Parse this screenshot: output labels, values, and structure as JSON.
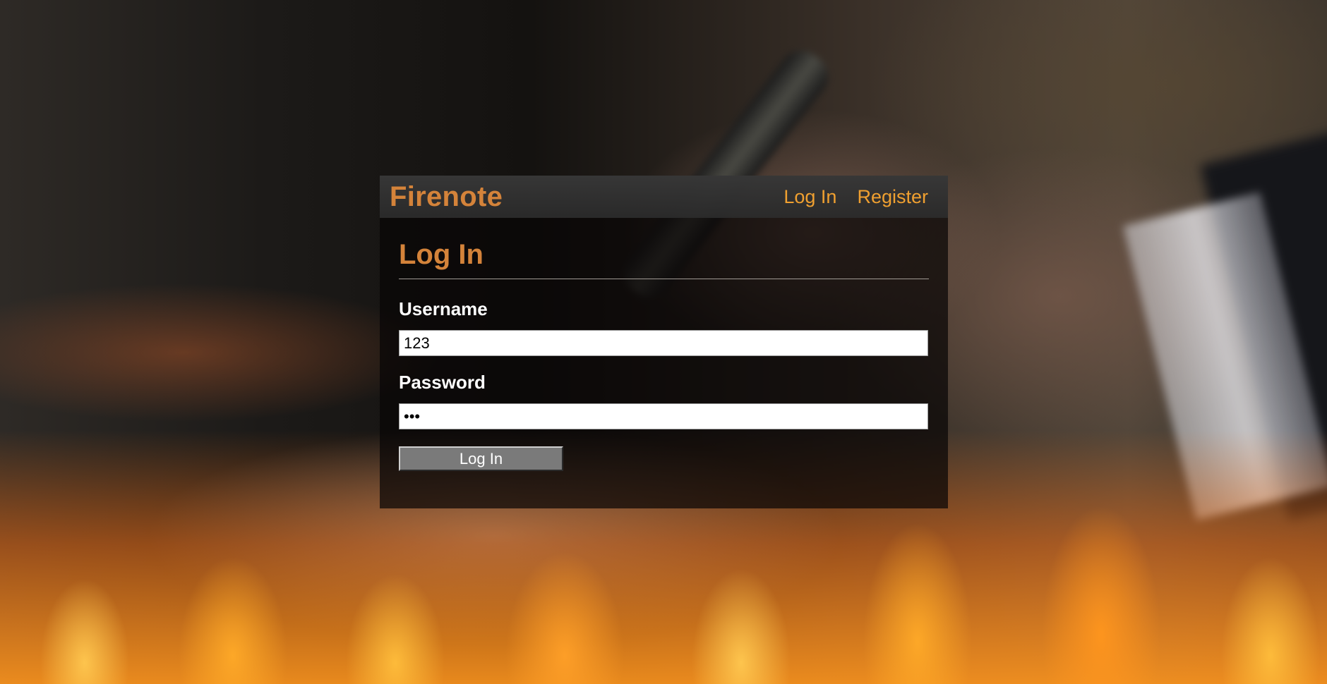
{
  "header": {
    "brand": "Firenote",
    "nav": {
      "login_label": "Log In",
      "register_label": "Register"
    }
  },
  "main": {
    "title": "Log In",
    "username": {
      "label": "Username",
      "value": "123"
    },
    "password": {
      "label": "Password",
      "value": "123"
    },
    "submit_label": "Log In"
  },
  "colors": {
    "brand_accent": "#d4833a",
    "nav_link": "#f0a030",
    "button_bg": "#7a7a7a"
  }
}
